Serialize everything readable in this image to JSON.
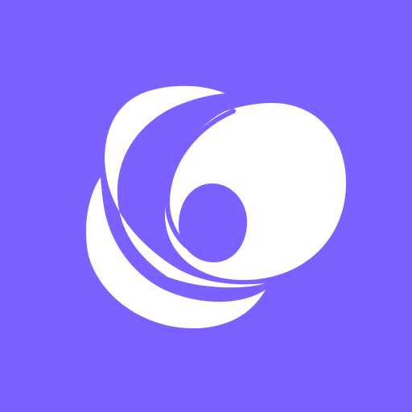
{
  "app_icon": {
    "name": "abstract-swirl-logo",
    "colors": {
      "background": "#7B61FF",
      "foreground": "#FFFFFF"
    }
  }
}
